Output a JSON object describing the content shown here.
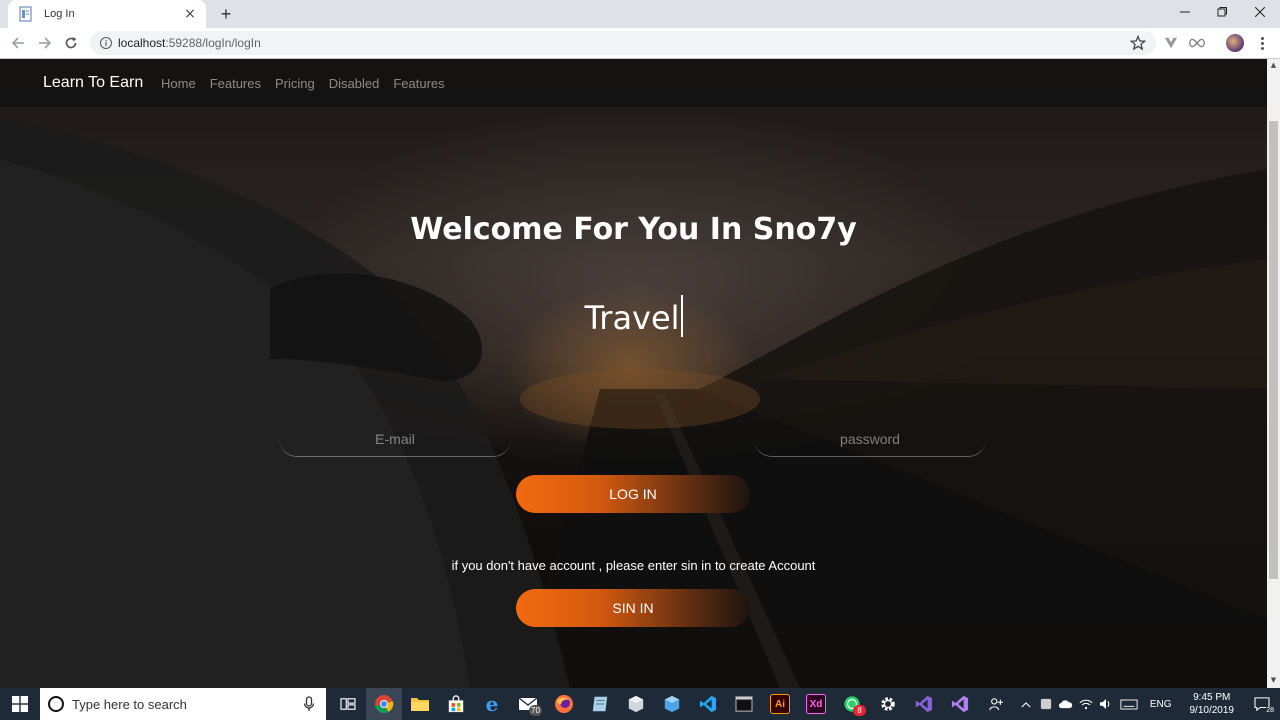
{
  "browser": {
    "tab_title": "Log In",
    "new_tab": "+",
    "close_tab": "×",
    "url_host": "localhost",
    "url_path": ":59288/logIn/logIn"
  },
  "site": {
    "brand": "Learn To Earn",
    "nav": [
      "Home",
      "Features",
      "Pricing",
      "Disabled",
      "Features"
    ]
  },
  "hero": {
    "welcome": "Welcome For You In Sno7y",
    "typed_word": "Travel"
  },
  "form": {
    "email_placeholder": "E-mail",
    "password_placeholder": "password",
    "login_label": "LOG IN",
    "hint": "if you don't have account , please enter sin in to create Account",
    "signin_label": "SIN IN"
  },
  "taskbar": {
    "search_placeholder": "Type here to search",
    "mail_badge": "70",
    "whatsapp_badge": "8",
    "language": "ENG",
    "time": "9:45 PM",
    "date": "9/10/2019",
    "notification_count": "28"
  },
  "colors": {
    "button_start": "#f26a0f",
    "button_end": "#1c1410",
    "taskbar": "#1f2a38"
  }
}
